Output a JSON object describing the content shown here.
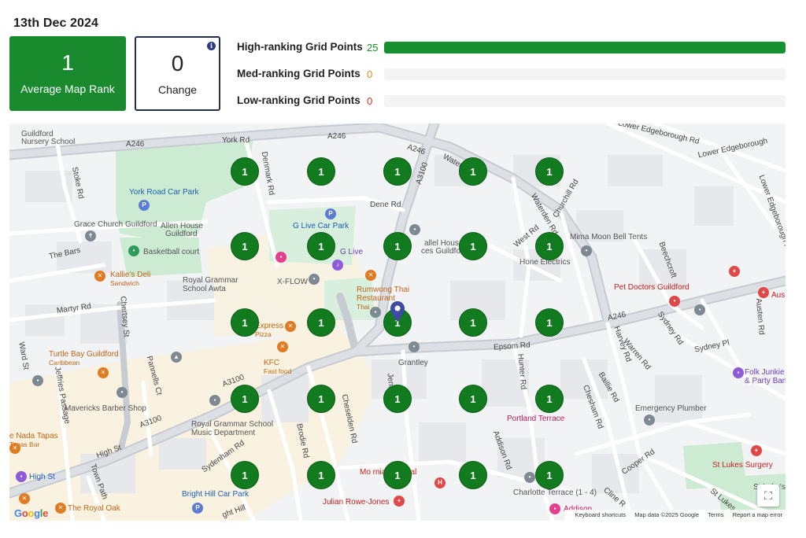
{
  "date": "13th Dec 2024",
  "cards": {
    "rank_value": "1",
    "rank_label": "Average Map Rank",
    "change_value": "0",
    "change_label": "Change",
    "info_icon": "i"
  },
  "ranking": [
    {
      "label": "High-ranking Grid Points",
      "count": "25",
      "fraction": 1.0,
      "color": "#17912f"
    },
    {
      "label": "Med-ranking Grid Points",
      "count": "0",
      "fraction": 0.0,
      "color": "#e08a14"
    },
    {
      "label": "Low-ranking Grid Points",
      "count": "0",
      "fraction": 0.0,
      "color": "#d93025"
    }
  ],
  "map": {
    "labels": {
      "guildford_nursery": "Guildford",
      "guildford_nursery2": "Nursery School",
      "a246_1": "A246",
      "a246_2": "A246",
      "a246_3": "A246",
      "a246_4": "A246",
      "york_rd": "York Rd",
      "lower_edgeborough": "Lower Edgeborough Rd",
      "lower_edgeborough2": "Lower Edgeborough",
      "lower_edgeborough3": "Lower Edgeborough Rd",
      "denmark_rd": "Denmark Rd",
      "a3100_1": "A3100",
      "york_road_car_park": "York Road Car Park",
      "stoke_rd": "Stoke Rd",
      "dene_rd": "Dene Rd",
      "grace_church": "Grace Church Guildford",
      "allen_house": "Allen House",
      "allen_house2": "Guildford",
      "g_live_car_park": "G Live Car Park",
      "chapel_house": "allel House",
      "chapel_house2": "ces Guildford",
      "west_rd": "West Rd",
      "waterden_rd": "Waterden Rd",
      "churchill_rd": "Churchill Rd",
      "mima_moon": "Mima Moon Bell Tents",
      "basketball": "Basketball court",
      "the_bars": "The Bars",
      "hone_electrics": "Hone Electrics",
      "beechcroft": "Beechcroft",
      "g_live": "G Live",
      "kallies_deli": "Kallie's Deli",
      "kallies_deli_sub": "Sandwich",
      "rgs_awta": "Royal Grammar",
      "rgs_awta2": "School Awta",
      "x_flow": "X-FLOW",
      "rumwong": "Rumwong Thai",
      "rumwong2": "Restaurant",
      "rumwong_sub": "Thai",
      "pet_doctors": "Pet Doctors Guildford",
      "aus": "Aus",
      "martyr_rd": "Martyr Rd",
      "chertsey_st": "Chertsey St",
      "express": "Express",
      "express_sub": "Pizza",
      "a246_epsom": "A246",
      "austen_rd": "Austen Rd",
      "sydney_rd": "Sydney Rd",
      "ward_st": "Ward St",
      "epsom_rd": "Epsom Rd",
      "harvey_rd": "Harvey Rd",
      "warren_rd": "Warren Rd",
      "sydney_pl": "Sydney Pl",
      "turtle_bay": "Turtle Bay Guildford",
      "turtle_bay_sub": "Caribbean",
      "kfc": "KFC",
      "kfc_sub": "Fast food",
      "grantley": "Grantley",
      "hunter_rd": "Hunter Rd",
      "folk_junkie": "Folk Junkie",
      "folk_junkie2": "& Party Ban",
      "jeffries": "Jeffries Passage",
      "pannells": "Pannells Ct",
      "a3100_2": "A3100",
      "a3100_3": "A3100",
      "mavericks": "Mavericks Barber Shop",
      "baillie_rd": "Baillie Rd",
      "emergency_plumber": "Emergency Plumber",
      "rgs_music": "Royal Grammar School",
      "rgs_music2": "Music Department",
      "chesham_rd": "Chesham Rd",
      "portland_terrace": "Portland Terrace",
      "nada_tapas": "e Nada Tapas",
      "nada_tapas_sub": "Tapas Bar",
      "brodie_rd": "Brodie Rd",
      "cheselden_rd": "Cheselden Rd",
      "high_st": "High St",
      "high_st_place": "High St",
      "sydenham_rd": "Sydenham Rd",
      "addison_rd": "Addison Rd",
      "cooper_rd": "Cooper Rd",
      "st_lukes_surgery": "St Lukes Surgery",
      "mount_alvernia": "Mo    rnia Hospital",
      "town_path": "Town Path",
      "bright_hill": "Bright Hill Car Park",
      "julian_rowe": "Julian Rowe-Jones",
      "charlotte_terrace": "Charlotte Terrace (1 - 4)",
      "the_royal_oak": "The Royal Oak",
      "addison": "Addison",
      "cline_rd": "Cline R",
      "st_lukes_sq": "St Lukes Sq",
      "st_lukes": "St Luke's",
      "jenner_rd": "Jenner Rd",
      "ght_hill": "ght Hill"
    },
    "grid_rank": "1",
    "grid_points": 25,
    "google": "Google",
    "attribution": {
      "shortcuts": "Keyboard shortcuts",
      "data": "Map data ©2025 Google",
      "terms": "Terms",
      "report": "Report a map error"
    },
    "fullscreen_icon": "⛶"
  }
}
